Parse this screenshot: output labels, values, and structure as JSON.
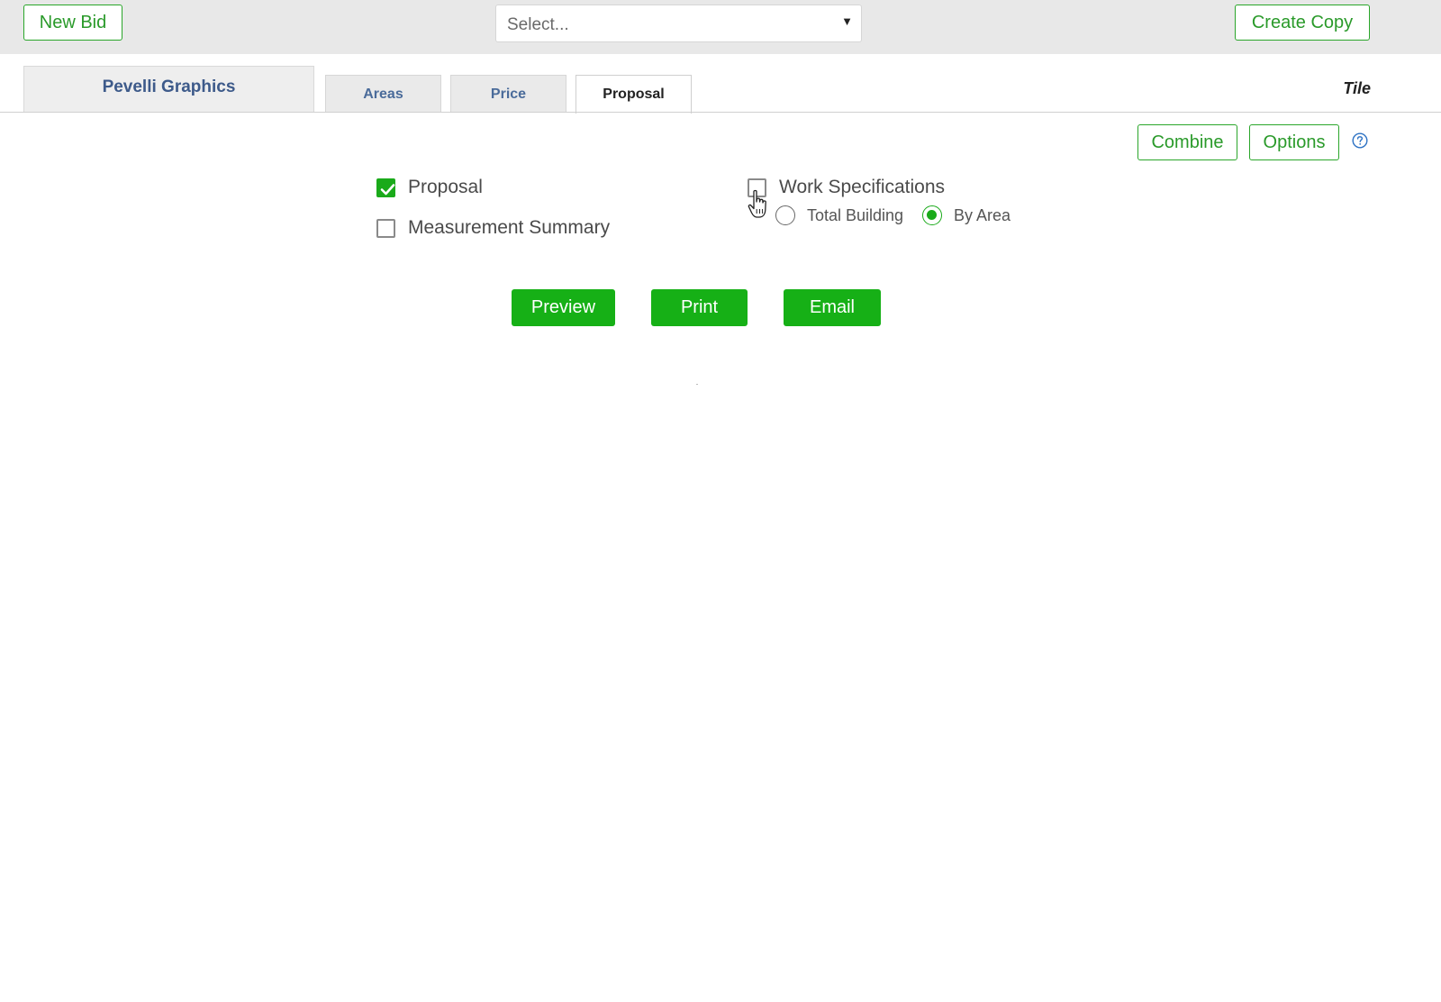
{
  "toolbar": {
    "new_bid_label": "New Bid",
    "select_placeholder": "Select...",
    "select_caret": "▾",
    "create_copy_label": "Create Copy"
  },
  "tabs": {
    "account_name": "Pevelli Graphics",
    "items": [
      {
        "label": "Areas",
        "active": false
      },
      {
        "label": "Price",
        "active": false
      },
      {
        "label": "Proposal",
        "active": true
      }
    ],
    "trade_label": "Tile"
  },
  "actions": {
    "combine_label": "Combine",
    "options_label": "Options",
    "help_icon": "question-circle-icon"
  },
  "documents": {
    "proposal": {
      "label": "Proposal",
      "checked": true
    },
    "measurement_summary": {
      "label": "Measurement Summary",
      "checked": false
    },
    "work_specifications": {
      "label": "Work Specifications",
      "checked": false
    },
    "spec_scope": {
      "options": [
        "Total Building",
        "By Area"
      ],
      "selected": "By Area"
    }
  },
  "output_buttons": {
    "preview_label": "Preview",
    "print_label": "Print",
    "email_label": "Email"
  },
  "colors": {
    "accent_green": "#16b016",
    "outline_green": "#2aa62a",
    "tab_text_blue": "#4a6b9a",
    "topbar_gray": "#e8e8e8"
  }
}
